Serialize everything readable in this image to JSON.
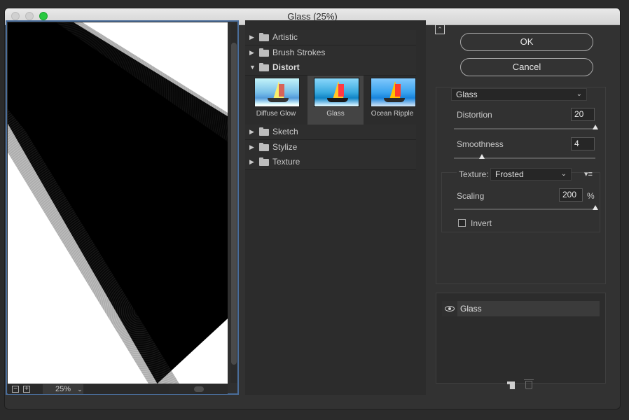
{
  "window": {
    "title": "Glass (25%)"
  },
  "preview": {
    "zoom": "25%",
    "zoom_out": "−",
    "zoom_in": "+"
  },
  "gallery": {
    "categories": [
      {
        "label": "Artistic",
        "open": false
      },
      {
        "label": "Brush Strokes",
        "open": false
      },
      {
        "label": "Distort",
        "open": true
      },
      {
        "label": "Sketch",
        "open": false
      },
      {
        "label": "Stylize",
        "open": false
      },
      {
        "label": "Texture",
        "open": false
      }
    ],
    "filters": [
      {
        "name": "Diffuse Glow",
        "selected": false
      },
      {
        "name": "Glass",
        "selected": true
      },
      {
        "name": "Ocean Ripple",
        "selected": false
      }
    ]
  },
  "buttons": {
    "ok": "OK",
    "cancel": "Cancel"
  },
  "settings": {
    "filter_select": "Glass",
    "distortion_label": "Distortion",
    "distortion_value": "20",
    "distortion_fraction": 1.0,
    "smoothness_label": "Smoothness",
    "smoothness_value": "4",
    "smoothness_fraction": 0.2,
    "texture_label": "Texture:",
    "texture_value": "Frosted",
    "scaling_label": "Scaling",
    "scaling_value": "200",
    "scaling_unit": "%",
    "scaling_fraction": 1.0,
    "invert_label": "Invert",
    "invert_checked": false
  },
  "layers": [
    {
      "name": "Glass",
      "visible": true
    }
  ],
  "icons": {
    "collapse": "collapse-icon",
    "texture_menu": "texture-menu-icon",
    "new_layer": "new-layer-icon",
    "delete_layer": "trash-icon",
    "eye": "eye-icon",
    "folder": "folder-icon"
  },
  "colors": {
    "accent_border": "#4a6d9a",
    "max_button": "#28c940"
  }
}
